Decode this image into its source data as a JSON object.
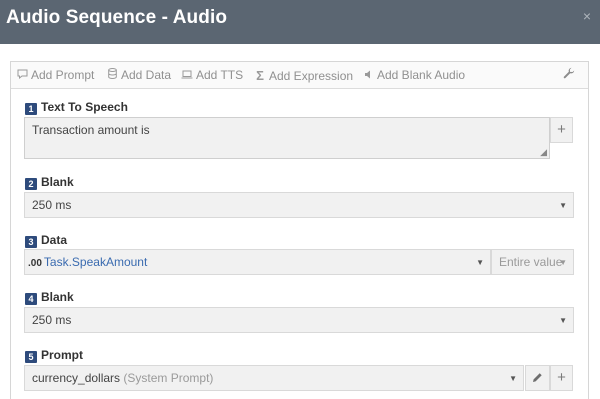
{
  "window": {
    "title": "Audio Sequence - Audio",
    "close_glyph": "×"
  },
  "toolbar": {
    "items": [
      {
        "label": "Add Prompt",
        "icon": "speech-bubble-icon"
      },
      {
        "label": "Add Data",
        "icon": "database-icon"
      },
      {
        "label": "Add TTS",
        "icon": "laptop-icon"
      },
      {
        "label": "Add Expression",
        "icon": "sigma-icon"
      },
      {
        "label": "Add Blank Audio",
        "icon": "volume-icon"
      }
    ],
    "settings_icon": "wrench-icon"
  },
  "steps": [
    {
      "number": "1",
      "label": "Text To Speech",
      "value": "Transaction amount is"
    },
    {
      "number": "2",
      "label": "Blank",
      "value": "250 ms"
    },
    {
      "number": "3",
      "label": "Data",
      "prefix": ".00",
      "value": "Task.SpeakAmount",
      "mode": "Entire value"
    },
    {
      "number": "4",
      "label": "Blank",
      "value": "250 ms"
    },
    {
      "number": "5",
      "label": "Prompt",
      "value": "currency_dollars",
      "source": "(System Prompt)"
    }
  ],
  "colors": {
    "titlebar": "#5b6672",
    "badge": "#2e4b7c",
    "link": "#3a6bb0"
  }
}
